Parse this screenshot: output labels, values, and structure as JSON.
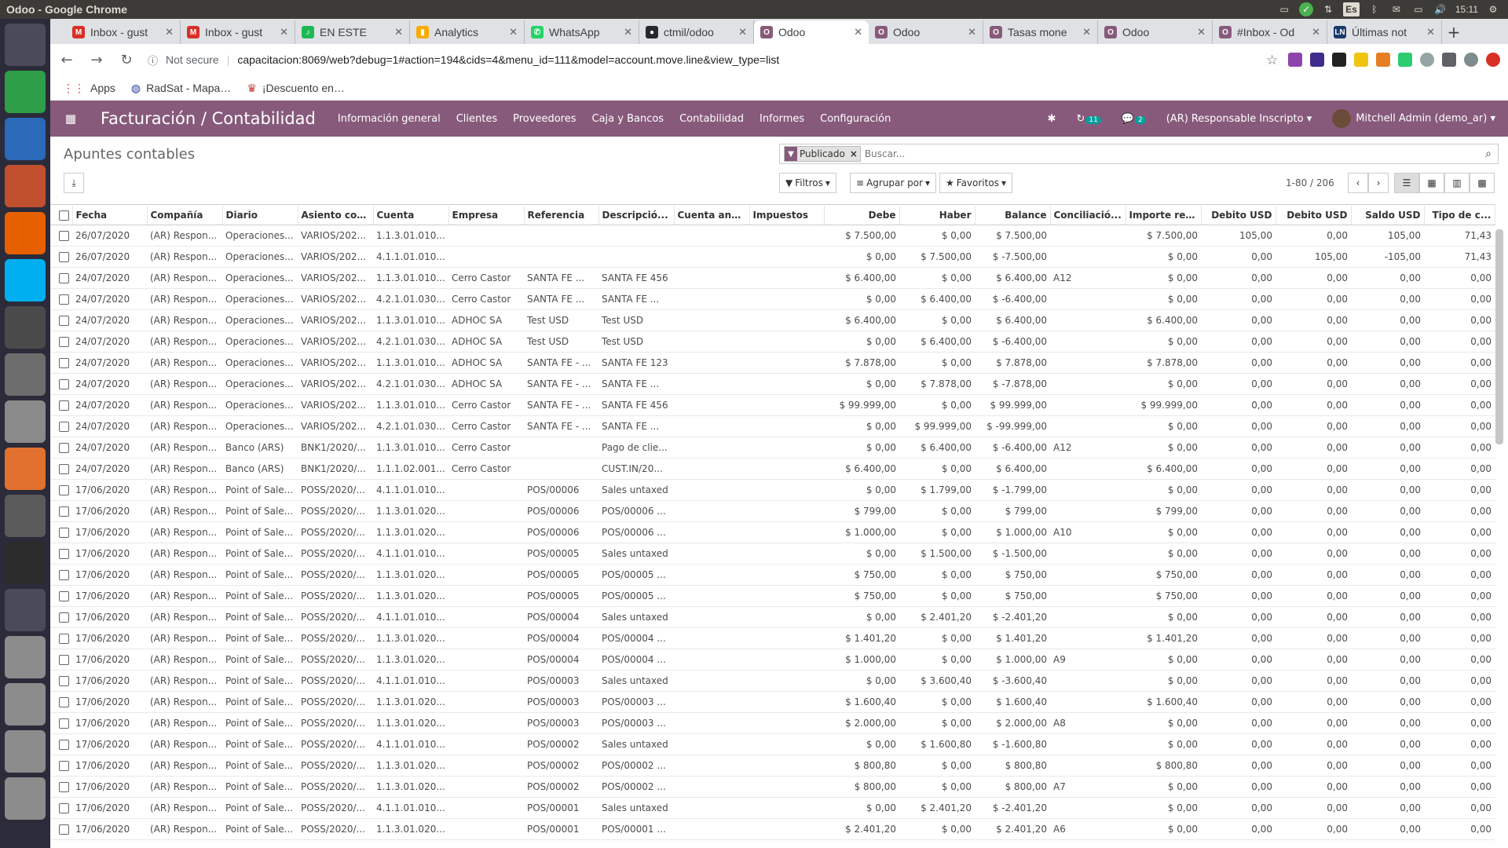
{
  "window_title": "Odoo - Google Chrome",
  "os": {
    "keyboard_layout": "Es",
    "time": "15:11"
  },
  "launcher_icons": [
    "ubuntu-icon",
    "spreadsheet-icon",
    "writer-icon",
    "impress-icon",
    "firefox-icon",
    "skype-icon",
    "chrome-icon",
    "settings-icon",
    "files-icon",
    "software-center-icon",
    "text-editor-icon",
    "terminal-icon",
    "workspace-icon",
    "disk-icon",
    "disk-icon",
    "disk-icon",
    "trash-icon"
  ],
  "tabs": [
    {
      "title": "Inbox - gust",
      "favicon_color": "#d93025",
      "fav": "M"
    },
    {
      "title": "Inbox - gust",
      "favicon_color": "#d93025",
      "fav": "M"
    },
    {
      "title": "EN ESTE",
      "favicon_color": "#1db954",
      "fav": "♪"
    },
    {
      "title": "Analytics",
      "favicon_color": "#f9ab00",
      "fav": "▮"
    },
    {
      "title": "WhatsApp",
      "favicon_color": "#25d366",
      "fav": "✆"
    },
    {
      "title": "ctmil/odoo",
      "favicon_color": "#24292e",
      "fav": "●"
    },
    {
      "title": "Odoo",
      "favicon_color": "#875a7b",
      "fav": "O",
      "active": true
    },
    {
      "title": "Odoo",
      "favicon_color": "#875a7b",
      "fav": "O"
    },
    {
      "title": "Tasas mone",
      "favicon_color": "#875a7b",
      "fav": "O"
    },
    {
      "title": "Odoo",
      "favicon_color": "#875a7b",
      "fav": "O"
    },
    {
      "title": "#Inbox - Od",
      "favicon_color": "#875a7b",
      "fav": "O"
    },
    {
      "title": "Últimas not",
      "favicon_color": "#1a3a6b",
      "fav": "LN"
    }
  ],
  "omnibox": {
    "security": "Not secure",
    "url": "capacitacion:8069/web?debug=1#action=194&cids=4&menu_id=111&model=account.move.line&view_type=list"
  },
  "bookmarks": [
    {
      "label": "Apps",
      "icon": "apps-grid-icon"
    },
    {
      "label": "RadSat - Mapa…",
      "icon": "globe-icon"
    },
    {
      "label": "¡Descuento en…",
      "icon": "store-icon"
    }
  ],
  "odoo": {
    "app_title": "Facturación / Contabilidad",
    "menus": [
      "Información general",
      "Clientes",
      "Proveedores",
      "Caja y Bancos",
      "Contabilidad",
      "Informes",
      "Configuración"
    ],
    "activity_badge": "11",
    "messages_badge": "2",
    "company": "(AR) Responsable Inscripto",
    "user": "Mitchell Admin (demo_ar)",
    "brand_color": "#875a7b"
  },
  "control_panel": {
    "title": "Apuntes contables",
    "facet": "Publicado",
    "search_placeholder": "Buscar...",
    "filters": "Filtros",
    "group_by": "Agrupar por",
    "favorites": "Favoritos",
    "pager": "1-80 / 206"
  },
  "table": {
    "columns": [
      "Fecha",
      "Compañía",
      "Diario",
      "Asiento con...",
      "Cuenta",
      "Empresa",
      "Referencia",
      "Descripció...",
      "Cuenta anal...",
      "Impuestos",
      "Debe",
      "Haber",
      "Balance",
      "Conciliació...",
      "Importe res...",
      "Debito USD",
      "Debito USD",
      "Saldo USD",
      "Tipo de c..."
    ],
    "rows": [
      [
        "26/07/2020",
        "(AR) Respon...",
        "Operaciones...",
        "VARIOS/202...",
        "1.1.3.01.010...",
        "",
        "",
        "",
        "",
        "",
        "$ 7.500,00",
        "$ 0,00",
        "$ 7.500,00",
        "",
        "$ 7.500,00",
        "105,00",
        "0,00",
        "105,00",
        "71,43"
      ],
      [
        "26/07/2020",
        "(AR) Respon...",
        "Operaciones...",
        "VARIOS/202...",
        "4.1.1.01.010...",
        "",
        "",
        "",
        "",
        "",
        "$ 0,00",
        "$ 7.500,00",
        "$ -7.500,00",
        "",
        "$ 0,00",
        "0,00",
        "105,00",
        "-105,00",
        "71,43"
      ],
      [
        "24/07/2020",
        "(AR) Respon...",
        "Operaciones...",
        "VARIOS/202...",
        "1.1.3.01.010...",
        "Cerro Castor",
        "SANTA FE ...",
        "SANTA FE 456",
        "",
        "",
        "$ 6.400,00",
        "$ 0,00",
        "$ 6.400,00",
        "A12",
        "$ 0,00",
        "0,00",
        "0,00",
        "0,00",
        "0,00"
      ],
      [
        "24/07/2020",
        "(AR) Respon...",
        "Operaciones...",
        "VARIOS/202...",
        "4.2.1.01.030...",
        "Cerro Castor",
        "SANTA FE ...",
        "SANTA FE ...",
        "",
        "",
        "$ 0,00",
        "$ 6.400,00",
        "$ -6.400,00",
        "",
        "$ 0,00",
        "0,00",
        "0,00",
        "0,00",
        "0,00"
      ],
      [
        "24/07/2020",
        "(AR) Respon...",
        "Operaciones...",
        "VARIOS/202...",
        "1.1.3.01.010...",
        "ADHOC SA",
        "Test USD",
        "Test USD",
        "",
        "",
        "$ 6.400,00",
        "$ 0,00",
        "$ 6.400,00",
        "",
        "$ 6.400,00",
        "0,00",
        "0,00",
        "0,00",
        "0,00"
      ],
      [
        "24/07/2020",
        "(AR) Respon...",
        "Operaciones...",
        "VARIOS/202...",
        "4.2.1.01.030...",
        "ADHOC SA",
        "Test USD",
        "Test USD",
        "",
        "",
        "$ 0,00",
        "$ 6.400,00",
        "$ -6.400,00",
        "",
        "$ 0,00",
        "0,00",
        "0,00",
        "0,00",
        "0,00"
      ],
      [
        "24/07/2020",
        "(AR) Respon...",
        "Operaciones...",
        "VARIOS/202...",
        "1.1.3.01.010...",
        "ADHOC SA",
        "SANTA FE - ...",
        "SANTA FE 123",
        "",
        "",
        "$ 7.878,00",
        "$ 0,00",
        "$ 7.878,00",
        "",
        "$ 7.878,00",
        "0,00",
        "0,00",
        "0,00",
        "0,00"
      ],
      [
        "24/07/2020",
        "(AR) Respon...",
        "Operaciones...",
        "VARIOS/202...",
        "4.2.1.01.030...",
        "ADHOC SA",
        "SANTA FE - ...",
        "SANTA FE ...",
        "",
        "",
        "$ 0,00",
        "$ 7.878,00",
        "$ -7.878,00",
        "",
        "$ 0,00",
        "0,00",
        "0,00",
        "0,00",
        "0,00"
      ],
      [
        "24/07/2020",
        "(AR) Respon...",
        "Operaciones...",
        "VARIOS/202...",
        "1.1.3.01.010...",
        "Cerro Castor",
        "SANTA FE - ...",
        "SANTA FE 456",
        "",
        "",
        "$ 99.999,00",
        "$ 0,00",
        "$ 99.999,00",
        "",
        "$ 99.999,00",
        "0,00",
        "0,00",
        "0,00",
        "0,00"
      ],
      [
        "24/07/2020",
        "(AR) Respon...",
        "Operaciones...",
        "VARIOS/202...",
        "4.2.1.01.030...",
        "Cerro Castor",
        "SANTA FE - ...",
        "SANTA FE ...",
        "",
        "",
        "$ 0,00",
        "$ 99.999,00",
        "$ -99.999,00",
        "",
        "$ 0,00",
        "0,00",
        "0,00",
        "0,00",
        "0,00"
      ],
      [
        "24/07/2020",
        "(AR) Respon...",
        "Banco (ARS)",
        "BNK1/2020/...",
        "1.1.3.01.010...",
        "Cerro Castor",
        "",
        "Pago de clie...",
        "",
        "",
        "$ 0,00",
        "$ 6.400,00",
        "$ -6.400,00",
        "A12",
        "$ 0,00",
        "0,00",
        "0,00",
        "0,00",
        "0,00"
      ],
      [
        "24/07/2020",
        "(AR) Respon...",
        "Banco (ARS)",
        "BNK1/2020/...",
        "1.1.1.02.001...",
        "Cerro Castor",
        "",
        "CUST.IN/20...",
        "",
        "",
        "$ 6.400,00",
        "$ 0,00",
        "$ 6.400,00",
        "",
        "$ 6.400,00",
        "0,00",
        "0,00",
        "0,00",
        "0,00"
      ],
      [
        "17/06/2020",
        "(AR) Respon...",
        "Point of Sale...",
        "POSS/2020/...",
        "4.1.1.01.010...",
        "",
        "POS/00006",
        "Sales untaxed",
        "",
        "",
        "$ 0,00",
        "$ 1.799,00",
        "$ -1.799,00",
        "",
        "$ 0,00",
        "0,00",
        "0,00",
        "0,00",
        "0,00"
      ],
      [
        "17/06/2020",
        "(AR) Respon...",
        "Point of Sale...",
        "POSS/2020/...",
        "1.1.3.01.020...",
        "",
        "POS/00006",
        "POS/00006 ...",
        "",
        "",
        "$ 799,00",
        "$ 0,00",
        "$ 799,00",
        "",
        "$ 799,00",
        "0,00",
        "0,00",
        "0,00",
        "0,00"
      ],
      [
        "17/06/2020",
        "(AR) Respon...",
        "Point of Sale...",
        "POSS/2020/...",
        "1.1.3.01.020...",
        "",
        "POS/00006",
        "POS/00006 ...",
        "",
        "",
        "$ 1.000,00",
        "$ 0,00",
        "$ 1.000,00",
        "A10",
        "$ 0,00",
        "0,00",
        "0,00",
        "0,00",
        "0,00"
      ],
      [
        "17/06/2020",
        "(AR) Respon...",
        "Point of Sale...",
        "POSS/2020/...",
        "4.1.1.01.010...",
        "",
        "POS/00005",
        "Sales untaxed",
        "",
        "",
        "$ 0,00",
        "$ 1.500,00",
        "$ -1.500,00",
        "",
        "$ 0,00",
        "0,00",
        "0,00",
        "0,00",
        "0,00"
      ],
      [
        "17/06/2020",
        "(AR) Respon...",
        "Point of Sale...",
        "POSS/2020/...",
        "1.1.3.01.020...",
        "",
        "POS/00005",
        "POS/00005 ...",
        "",
        "",
        "$ 750,00",
        "$ 0,00",
        "$ 750,00",
        "",
        "$ 750,00",
        "0,00",
        "0,00",
        "0,00",
        "0,00"
      ],
      [
        "17/06/2020",
        "(AR) Respon...",
        "Point of Sale...",
        "POSS/2020/...",
        "1.1.3.01.020...",
        "",
        "POS/00005",
        "POS/00005 ...",
        "",
        "",
        "$ 750,00",
        "$ 0,00",
        "$ 750,00",
        "",
        "$ 750,00",
        "0,00",
        "0,00",
        "0,00",
        "0,00"
      ],
      [
        "17/06/2020",
        "(AR) Respon...",
        "Point of Sale...",
        "POSS/2020/...",
        "4.1.1.01.010...",
        "",
        "POS/00004",
        "Sales untaxed",
        "",
        "",
        "$ 0,00",
        "$ 2.401,20",
        "$ -2.401,20",
        "",
        "$ 0,00",
        "0,00",
        "0,00",
        "0,00",
        "0,00"
      ],
      [
        "17/06/2020",
        "(AR) Respon...",
        "Point of Sale...",
        "POSS/2020/...",
        "1.1.3.01.020...",
        "",
        "POS/00004",
        "POS/00004 ...",
        "",
        "",
        "$ 1.401,20",
        "$ 0,00",
        "$ 1.401,20",
        "",
        "$ 1.401,20",
        "0,00",
        "0,00",
        "0,00",
        "0,00"
      ],
      [
        "17/06/2020",
        "(AR) Respon...",
        "Point of Sale...",
        "POSS/2020/...",
        "1.1.3.01.020...",
        "",
        "POS/00004",
        "POS/00004 ...",
        "",
        "",
        "$ 1.000,00",
        "$ 0,00",
        "$ 1.000,00",
        "A9",
        "$ 0,00",
        "0,00",
        "0,00",
        "0,00",
        "0,00"
      ],
      [
        "17/06/2020",
        "(AR) Respon...",
        "Point of Sale...",
        "POSS/2020/...",
        "4.1.1.01.010...",
        "",
        "POS/00003",
        "Sales untaxed",
        "",
        "",
        "$ 0,00",
        "$ 3.600,40",
        "$ -3.600,40",
        "",
        "$ 0,00",
        "0,00",
        "0,00",
        "0,00",
        "0,00"
      ],
      [
        "17/06/2020",
        "(AR) Respon...",
        "Point of Sale...",
        "POSS/2020/...",
        "1.1.3.01.020...",
        "",
        "POS/00003",
        "POS/00003 ...",
        "",
        "",
        "$ 1.600,40",
        "$ 0,00",
        "$ 1.600,40",
        "",
        "$ 1.600,40",
        "0,00",
        "0,00",
        "0,00",
        "0,00"
      ],
      [
        "17/06/2020",
        "(AR) Respon...",
        "Point of Sale...",
        "POSS/2020/...",
        "1.1.3.01.020...",
        "",
        "POS/00003",
        "POS/00003 ...",
        "",
        "",
        "$ 2.000,00",
        "$ 0,00",
        "$ 2.000,00",
        "A8",
        "$ 0,00",
        "0,00",
        "0,00",
        "0,00",
        "0,00"
      ],
      [
        "17/06/2020",
        "(AR) Respon...",
        "Point of Sale...",
        "POSS/2020/...",
        "4.1.1.01.010...",
        "",
        "POS/00002",
        "Sales untaxed",
        "",
        "",
        "$ 0,00",
        "$ 1.600,80",
        "$ -1.600,80",
        "",
        "$ 0,00",
        "0,00",
        "0,00",
        "0,00",
        "0,00"
      ],
      [
        "17/06/2020",
        "(AR) Respon...",
        "Point of Sale...",
        "POSS/2020/...",
        "1.1.3.01.020...",
        "",
        "POS/00002",
        "POS/00002 ...",
        "",
        "",
        "$ 800,80",
        "$ 0,00",
        "$ 800,80",
        "",
        "$ 800,80",
        "0,00",
        "0,00",
        "0,00",
        "0,00"
      ],
      [
        "17/06/2020",
        "(AR) Respon...",
        "Point of Sale...",
        "POSS/2020/...",
        "1.1.3.01.020...",
        "",
        "POS/00002",
        "POS/00002 ...",
        "",
        "",
        "$ 800,00",
        "$ 0,00",
        "$ 800,00",
        "A7",
        "$ 0,00",
        "0,00",
        "0,00",
        "0,00",
        "0,00"
      ],
      [
        "17/06/2020",
        "(AR) Respon...",
        "Point of Sale...",
        "POSS/2020/...",
        "4.1.1.01.010...",
        "",
        "POS/00001",
        "Sales untaxed",
        "",
        "",
        "$ 0,00",
        "$ 2.401,20",
        "$ -2.401,20",
        "",
        "$ 0,00",
        "0,00",
        "0,00",
        "0,00",
        "0,00"
      ],
      [
        "17/06/2020",
        "(AR) Respon...",
        "Point of Sale...",
        "POSS/2020/...",
        "1.1.3.01.020...",
        "",
        "POS/00001",
        "POS/00001 ...",
        "",
        "",
        "$ 2.401,20",
        "$ 0,00",
        "$ 2.401,20",
        "A6",
        "$ 0,00",
        "0,00",
        "0,00",
        "0,00",
        "0,00"
      ]
    ]
  }
}
